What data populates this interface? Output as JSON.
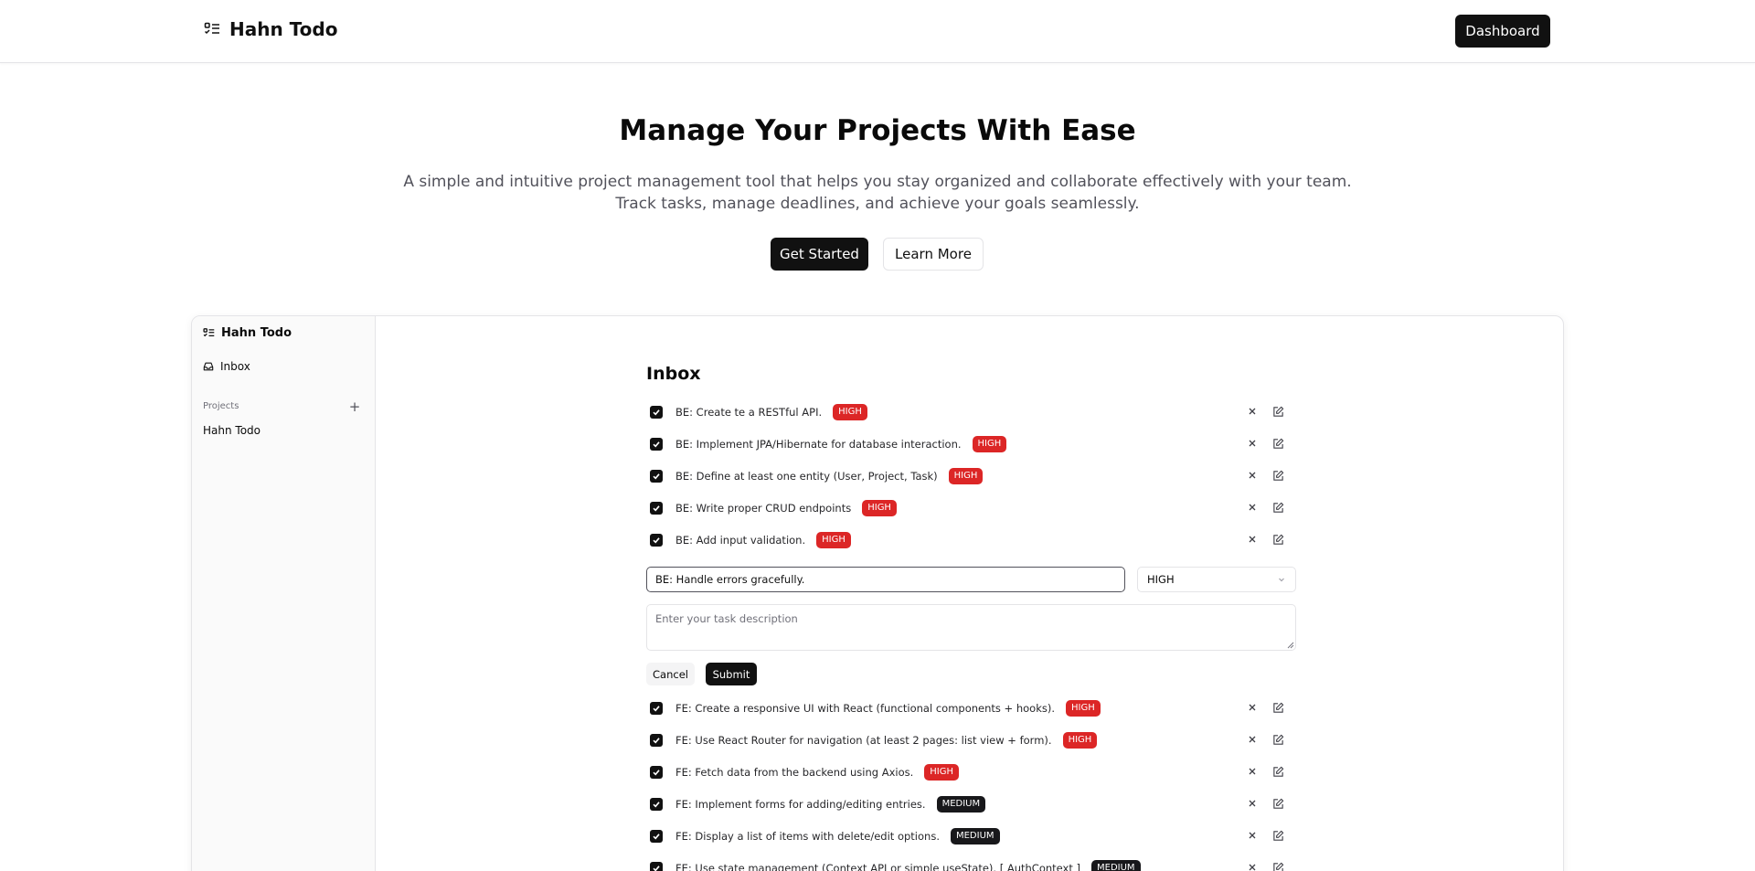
{
  "nav": {
    "brand": "Hahn Todo",
    "dashboard_label": "Dashboard"
  },
  "hero": {
    "title": "Manage Your Projects With Ease",
    "subtitle_line1": "A simple and intuitive project management tool that helps you stay organized and collaborate effectively with your team.",
    "subtitle_line2": "Track tasks, manage deadlines, and achieve your goals seamlessly.",
    "get_started_label": "Get Started",
    "learn_more_label": "Learn More"
  },
  "sidebar": {
    "brand": "Hahn Todo",
    "inbox_label": "Inbox",
    "projects_heading": "Projects",
    "add_label": "+",
    "projects": [
      "Hahn Todo"
    ]
  },
  "main": {
    "title": "Inbox",
    "tasks_before": [
      {
        "text": "BE: Create te a RESTful API.",
        "priority": "HIGH",
        "done": true
      },
      {
        "text": "BE: Implement JPA/Hibernate for database interaction.",
        "priority": "HIGH",
        "done": true
      },
      {
        "text": "BE: Define at least one entity (User, Project, Task)",
        "priority": "HIGH",
        "done": true
      },
      {
        "text": "BE: Write proper CRUD endpoints",
        "priority": "HIGH",
        "done": true
      },
      {
        "text": "BE: Add input validation.",
        "priority": "HIGH",
        "done": true
      }
    ],
    "edit_form": {
      "title_value": "BE: Handle errors gracefully.",
      "priority_value": "HIGH",
      "description_placeholder": "Enter your task description",
      "description_value": "",
      "cancel_label": "Cancel",
      "submit_label": "Submit"
    },
    "tasks_after": [
      {
        "text": "FE: Create a responsive UI with React (functional components + hooks).",
        "priority": "HIGH",
        "done": true
      },
      {
        "text": "FE: Use React Router for navigation (at least 2 pages: list view + form).",
        "priority": "HIGH",
        "done": true
      },
      {
        "text": "FE: Fetch data from the backend using Axios.",
        "priority": "HIGH",
        "done": true
      },
      {
        "text": "FE: Implement forms for adding/editing entries.",
        "priority": "MEDIUM",
        "done": true
      },
      {
        "text": "FE: Display a list of items with delete/edit options.",
        "priority": "MEDIUM",
        "done": true
      },
      {
        "text": "FE: Use state management (Context API or simple useState). [ AuthContext ]",
        "priority": "MEDIUM",
        "done": true
      }
    ]
  },
  "colors": {
    "high": "#dc2626",
    "medium": "#18181b",
    "primary": "#111111"
  }
}
